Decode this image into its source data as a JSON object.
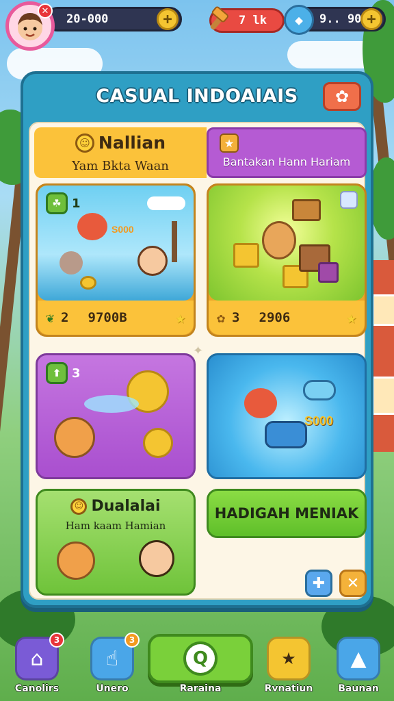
{
  "hud": {
    "avatar_badge": "✕",
    "coins": "20-000",
    "energy": "7 lk",
    "gems": "9.. 90"
  },
  "panel": {
    "title": "CASUAL INDOAIAIS",
    "banner_left": {
      "title": "Nallian",
      "subtitle": "Yam Bkta Waan"
    },
    "banner_right": {
      "subtitle": "Bantakan Hann Hariam"
    },
    "cards": [
      {
        "badge": "1",
        "footer_num": "2",
        "footer_value": "9700B",
        "art_label": "S000"
      },
      {
        "footer_num": "3",
        "footer_value": "2906"
      },
      {
        "badge": "3"
      },
      {
        "art_label": "S000"
      }
    ],
    "bottom_left": {
      "title": "Dualalai",
      "subtitle": "Ham kaam Hamian"
    },
    "bottom_right": {
      "label": "HADIGAH MENIAK"
    }
  },
  "nav": {
    "items": [
      {
        "label": "Canolirs",
        "badge": "3",
        "color": "#7a5bd6",
        "badge_color": "#e8353a"
      },
      {
        "label": "Unero",
        "badge": "3",
        "color": "#4aa6e8",
        "badge_color": "#f39a1f"
      },
      {
        "label": "Raraina",
        "color": "#7ad03a"
      },
      {
        "label": "Rvnatiun",
        "color": "#f4c531"
      },
      {
        "label": "Baunan",
        "color": "#4aa6e8"
      }
    ]
  },
  "colors": {
    "panel_frame": "#2f9fc4",
    "banner_yellow": "#fbc23a",
    "banner_purple": "#b55bd3",
    "green_card": "#7ad03a"
  }
}
